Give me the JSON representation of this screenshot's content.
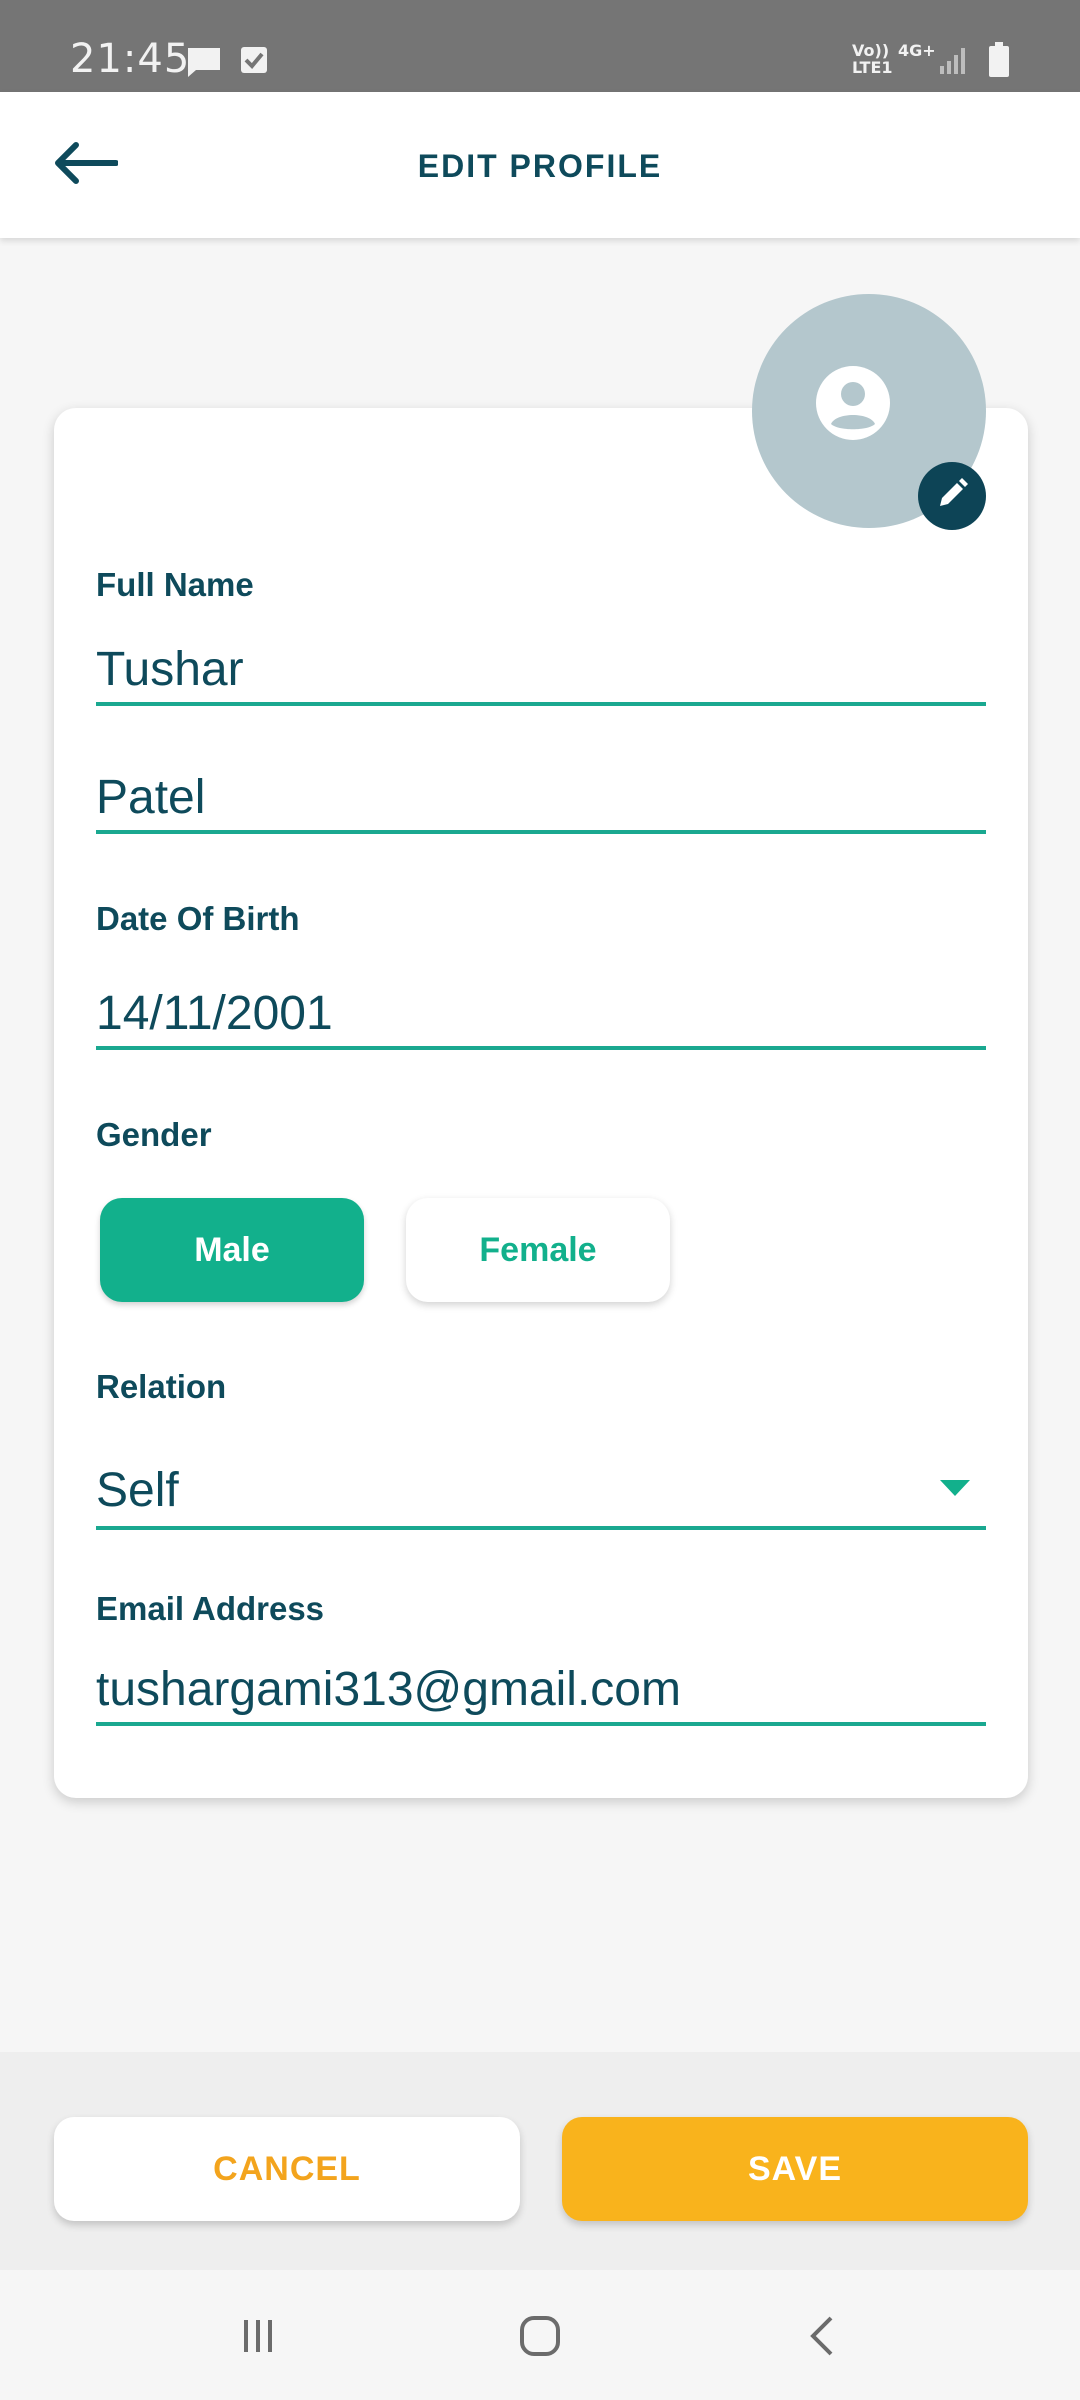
{
  "status_bar": {
    "time": "21:45",
    "network_label": "Vo)) LTE1",
    "network_type": "4G+",
    "icons": [
      "message-icon",
      "check-icon",
      "signal-icon",
      "battery-icon"
    ]
  },
  "header": {
    "title": "EDIT PROFILE",
    "back_icon": "arrow-left-icon"
  },
  "profile": {
    "avatar_icon": "account-circle-icon",
    "edit_icon": "pencil-icon"
  },
  "form": {
    "full_name_label": "Full Name",
    "first_name": "Tushar",
    "last_name": "Patel",
    "dob_label": "Date Of Birth",
    "dob": "14/11/2001",
    "gender_label": "Gender",
    "gender_options": [
      "Male",
      "Female"
    ],
    "gender_selected": "Male",
    "relation_label": "Relation",
    "relation": "Self",
    "email_label": "Email Address",
    "email": "tushargami313@gmail.com"
  },
  "actions": {
    "cancel_label": "CANCEL",
    "save_label": "SAVE"
  },
  "colors": {
    "primary_dark": "#0e4a5b",
    "accent_green": "#12b08c",
    "accent_orange": "#f9b31c"
  }
}
